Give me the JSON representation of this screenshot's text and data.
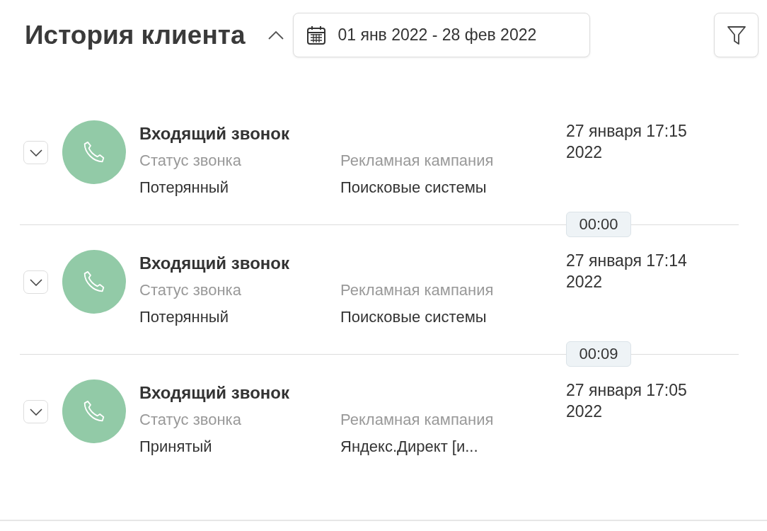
{
  "header": {
    "title": "История клиента",
    "expanded": true,
    "date_range": "01 янв 2022 - 28 фев 2022"
  },
  "calls": [
    {
      "title": "Входящий звонок",
      "status_label": "Статус звонка",
      "status": "Потерянный",
      "campaign_label": "Рекламная кампания",
      "campaign": "Поисковые системы",
      "date": "27 января 17:15",
      "year": "2022",
      "expanded": false,
      "duration": "00:00"
    },
    {
      "title": "Входящий звонок",
      "status_label": "Статус звонка",
      "status": "Потерянный",
      "campaign_label": "Рекламная кампания",
      "campaign": "Поисковые системы",
      "date": "27 января 17:14",
      "year": "2022",
      "expanded": false,
      "duration": "00:09"
    },
    {
      "title": "Входящий звонок",
      "status_label": "Статус звонка",
      "status": "Принятый",
      "campaign_label": "Рекламная кампания",
      "campaign": "Яндекс.Директ [и...",
      "date": "27 января 17:05",
      "year": "2022",
      "expanded": false
    }
  ]
}
